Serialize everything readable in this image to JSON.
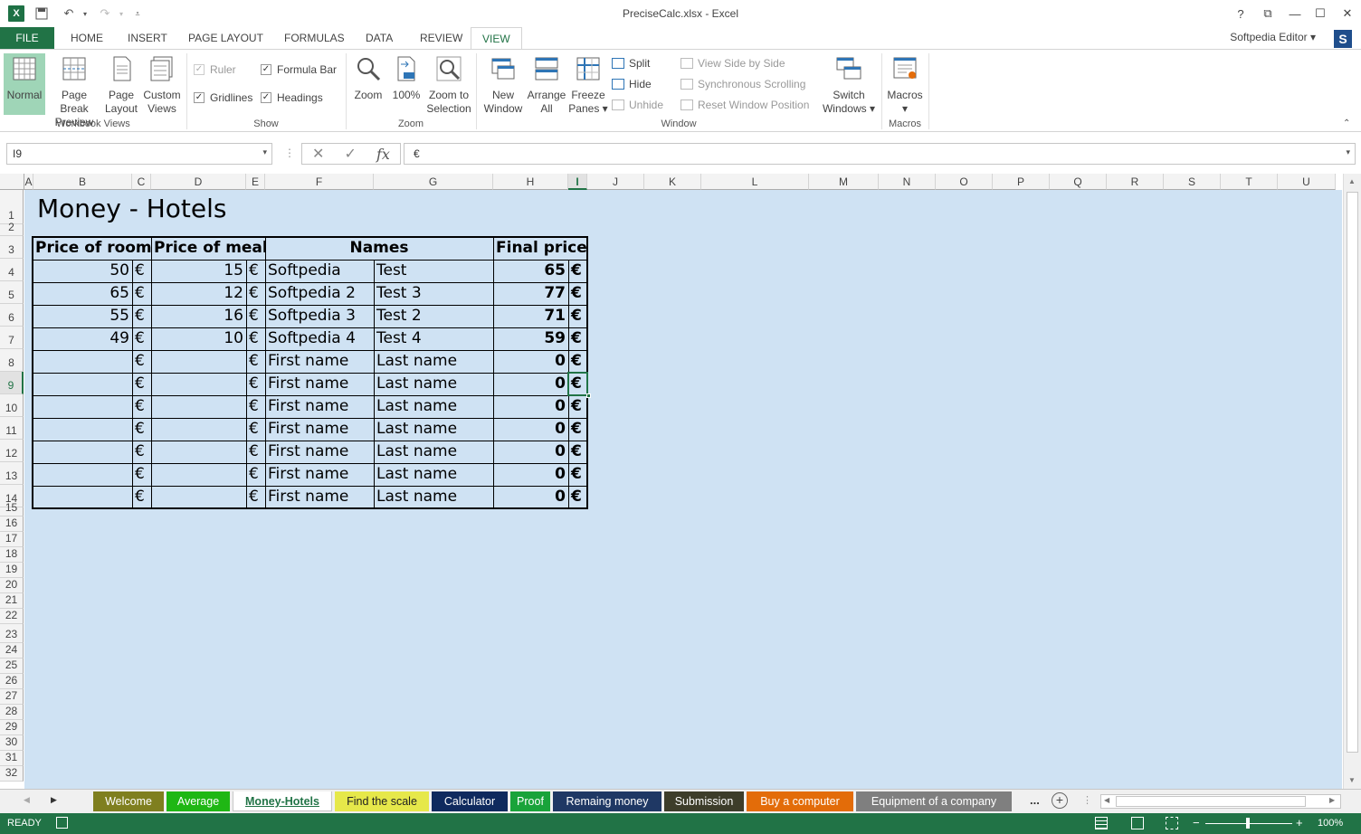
{
  "window": {
    "title": "PreciseCalc.xlsx - Excel",
    "app_icon": "X",
    "help": "?",
    "user_name": "Softpedia Editor",
    "user_initial": "S"
  },
  "ribbon_tabs": [
    "FILE",
    "HOME",
    "INSERT",
    "PAGE LAYOUT",
    "FORMULAS",
    "DATA",
    "REVIEW",
    "VIEW"
  ],
  "ribbon": {
    "workbook_views": {
      "label": "Workbook Views",
      "normal": "Normal",
      "page_break_1": "Page Break",
      "page_break_2": "Preview",
      "page_layout_1": "Page",
      "page_layout_2": "Layout",
      "custom_1": "Custom",
      "custom_2": "Views"
    },
    "show": {
      "label": "Show",
      "ruler": "Ruler",
      "formula_bar": "Formula Bar",
      "gridlines": "Gridlines",
      "headings": "Headings"
    },
    "zoom": {
      "label": "Zoom",
      "zoom": "Zoom",
      "hundred": "100%",
      "zoom_sel_1": "Zoom to",
      "zoom_sel_2": "Selection"
    },
    "window_group": {
      "label": "Window",
      "new_1": "New",
      "new_2": "Window",
      "arrange_1": "Arrange",
      "arrange_2": "All",
      "freeze_1": "Freeze",
      "freeze_2": "Panes",
      "split": "Split",
      "hide": "Hide",
      "unhide": "Unhide",
      "side_by_side": "View Side by Side",
      "sync_scroll": "Synchronous Scrolling",
      "reset_pos": "Reset Window Position",
      "switch_1": "Switch",
      "switch_2": "Windows"
    },
    "macros": {
      "label": "Macros",
      "macros": "Macros"
    }
  },
  "formula_bar": {
    "name_box": "I9",
    "fx": "fx",
    "content": "€"
  },
  "columns": [
    "A",
    "B",
    "C",
    "D",
    "E",
    "F",
    "G",
    "H",
    "I",
    "J",
    "K",
    "L",
    "M",
    "N",
    "O",
    "P",
    "Q",
    "R",
    "S",
    "T",
    "U"
  ],
  "rows": [
    "1",
    "2",
    "3",
    "4",
    "5",
    "6",
    "7",
    "8",
    "9",
    "10",
    "11",
    "12",
    "13",
    "14",
    "15",
    "16",
    "17",
    "18",
    "19",
    "20",
    "21",
    "22",
    "23",
    "24",
    "25",
    "26",
    "27",
    "28",
    "29",
    "30",
    "31",
    "32"
  ],
  "sheet": {
    "title": "Money - Hotels",
    "headers": {
      "price_room": "Price of room",
      "price_meal": "Price of meal",
      "names": "Names",
      "final_price": "Final price"
    },
    "currency": "€",
    "data_rows": [
      {
        "room": "50",
        "meal": "15",
        "first": "Softpedia",
        "last": "Test",
        "final": "65"
      },
      {
        "room": "65",
        "meal": "12",
        "first": "Softpedia 2",
        "last": "Test 3",
        "final": "77"
      },
      {
        "room": "55",
        "meal": "16",
        "first": "Softpedia 3",
        "last": "Test 2",
        "final": "71"
      },
      {
        "room": "49",
        "meal": "10",
        "first": "Softpedia 4",
        "last": "Test 4",
        "final": "59"
      },
      {
        "room": "",
        "meal": "",
        "first": "First name",
        "last": "Last name",
        "final": "0"
      },
      {
        "room": "",
        "meal": "",
        "first": "First name",
        "last": "Last name",
        "final": "0"
      },
      {
        "room": "",
        "meal": "",
        "first": "First name",
        "last": "Last name",
        "final": "0"
      },
      {
        "room": "",
        "meal": "",
        "first": "First name",
        "last": "Last name",
        "final": "0"
      },
      {
        "room": "",
        "meal": "",
        "first": "First name",
        "last": "Last name",
        "final": "0"
      },
      {
        "room": "",
        "meal": "",
        "first": "First name",
        "last": "Last name",
        "final": "0"
      },
      {
        "room": "",
        "meal": "",
        "first": "First name",
        "last": "Last name",
        "final": "0"
      }
    ]
  },
  "sheet_tabs": [
    {
      "label": "Welcome",
      "bg": "#7f7f1f",
      "fg": "#ffffff"
    },
    {
      "label": "Average",
      "bg": "#1fb714",
      "fg": "#ffffff"
    },
    {
      "label": "Money-Hotels",
      "bg": "#ffffff",
      "fg": "#217346"
    },
    {
      "label": "Find the scale",
      "bg": "#e6e84a",
      "fg": "#222222"
    },
    {
      "label": "Calculator",
      "bg": "#0f2a5e",
      "fg": "#ffffff"
    },
    {
      "label": "Proof",
      "bg": "#19a33a",
      "fg": "#ffffff"
    },
    {
      "label": "Remaing money",
      "bg": "#1f3864",
      "fg": "#ffffff"
    },
    {
      "label": "Submission",
      "bg": "#3d3d2a",
      "fg": "#ffffff"
    },
    {
      "label": "Buy a computer",
      "bg": "#e36c09",
      "fg": "#ffffff"
    },
    {
      "label": "Equipment of a company",
      "bg": "#7f7f7f",
      "fg": "#ffffff"
    }
  ],
  "more_tabs": "...",
  "status": {
    "ready": "READY",
    "zoom": "100%"
  },
  "colors": {
    "excel_green": "#217346",
    "sheet_bg": "#cfe2f3"
  }
}
